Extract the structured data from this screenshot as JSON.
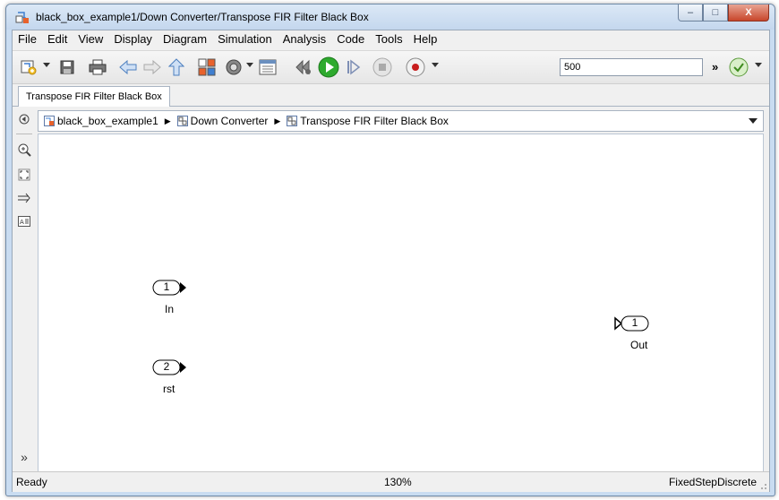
{
  "window": {
    "title": "black_box_example1/Down Converter/Transpose FIR Filter Black Box",
    "controls": {
      "minimize": "–",
      "maximize": "□",
      "close": "X"
    }
  },
  "menu": [
    "File",
    "Edit",
    "View",
    "Display",
    "Diagram",
    "Simulation",
    "Analysis",
    "Code",
    "Tools",
    "Help"
  ],
  "toolbar": {
    "stop_time": "500",
    "overflow": "»"
  },
  "tab": {
    "label": "Transpose FIR Filter Black Box"
  },
  "breadcrumb": {
    "items": [
      "black_box_example1",
      "Down Converter",
      "Transpose FIR Filter Black Box"
    ],
    "separator": "▶"
  },
  "left_toolbar": {
    "expand": "»"
  },
  "canvas": {
    "inports": [
      {
        "number": "1",
        "label": "In"
      },
      {
        "number": "2",
        "label": "rst"
      }
    ],
    "outports": [
      {
        "number": "1",
        "label": "Out"
      }
    ]
  },
  "status": {
    "state": "Ready",
    "zoom": "130%",
    "solver": "FixedStepDiscrete"
  },
  "colors": {
    "accent": "#3f7fd0",
    "run": "#2eaa2e",
    "record": "#c81e1e"
  }
}
